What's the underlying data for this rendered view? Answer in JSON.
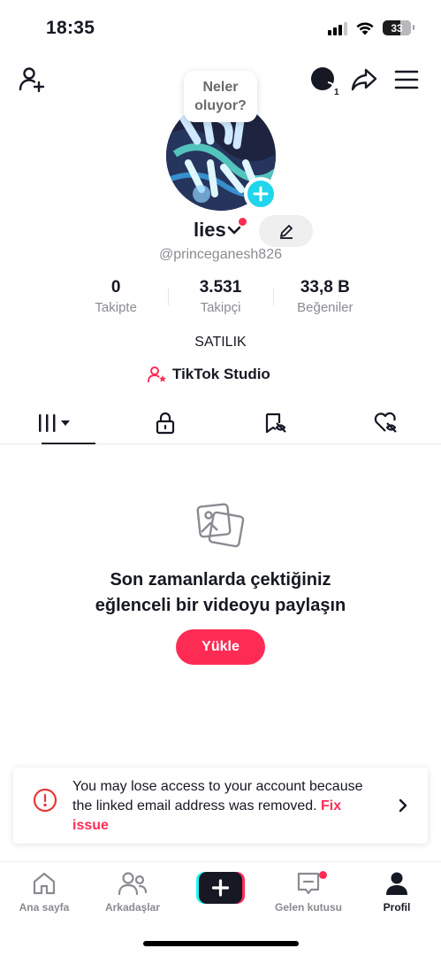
{
  "status_bar": {
    "time": "18:35",
    "battery": "33"
  },
  "bubble": {
    "text_line1": "Neler",
    "text_line2": "oluyor?"
  },
  "top_bar": {
    "now_badge": "1"
  },
  "profile": {
    "username": "lies",
    "handle": "@princeganesh826",
    "bio": "SATILIK",
    "studio_link": "TikTok Studio"
  },
  "stats": [
    {
      "value": "0",
      "label": "Takipte"
    },
    {
      "value": "3.531",
      "label": "Takipçi"
    },
    {
      "value": "33,8 B",
      "label": "Beğeniler"
    }
  ],
  "empty_state": {
    "title_line1": "Son zamanlarda çektiğiniz",
    "title_line2": "eğlenceli bir videoyu paylaşın",
    "upload_label": "Yükle"
  },
  "warning": {
    "message": "You may lose access to your account because the linked email address was removed.",
    "fix_label": "Fix issue"
  },
  "bottom_nav": {
    "home": "Ana sayfa",
    "friends": "Arkadaşlar",
    "inbox": "Gelen kutusu",
    "profile": "Profil"
  },
  "colors": {
    "accent": "#fe2c55",
    "teal": "#20d5ec",
    "text": "#161823",
    "muted": "#8a8b91"
  }
}
